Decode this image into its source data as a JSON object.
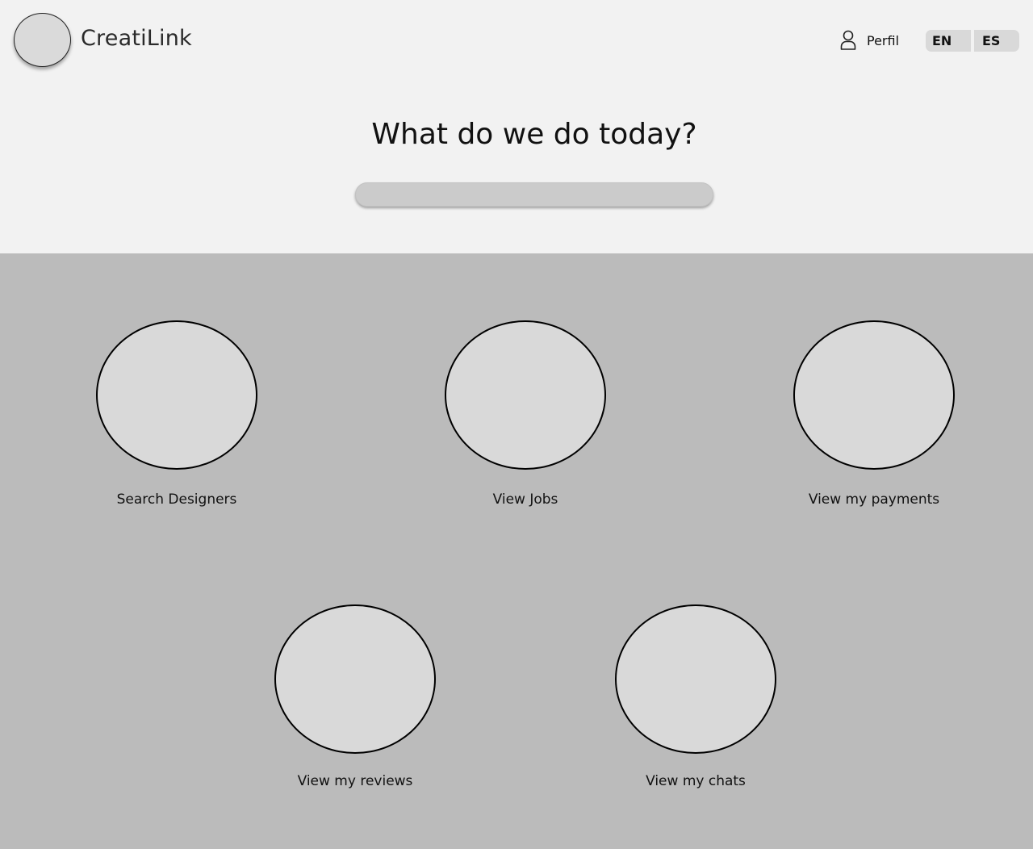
{
  "header": {
    "brand": "CreatiLink",
    "profile_label": "Perfil",
    "languages": [
      "EN",
      "ES"
    ]
  },
  "hero": {
    "headline": "What do we do today?",
    "search_value": ""
  },
  "tiles": [
    {
      "label": "Search Designers"
    },
    {
      "label": "View Jobs"
    },
    {
      "label": "View my payments"
    },
    {
      "label": "View my reviews"
    },
    {
      "label": "View my chats"
    }
  ]
}
